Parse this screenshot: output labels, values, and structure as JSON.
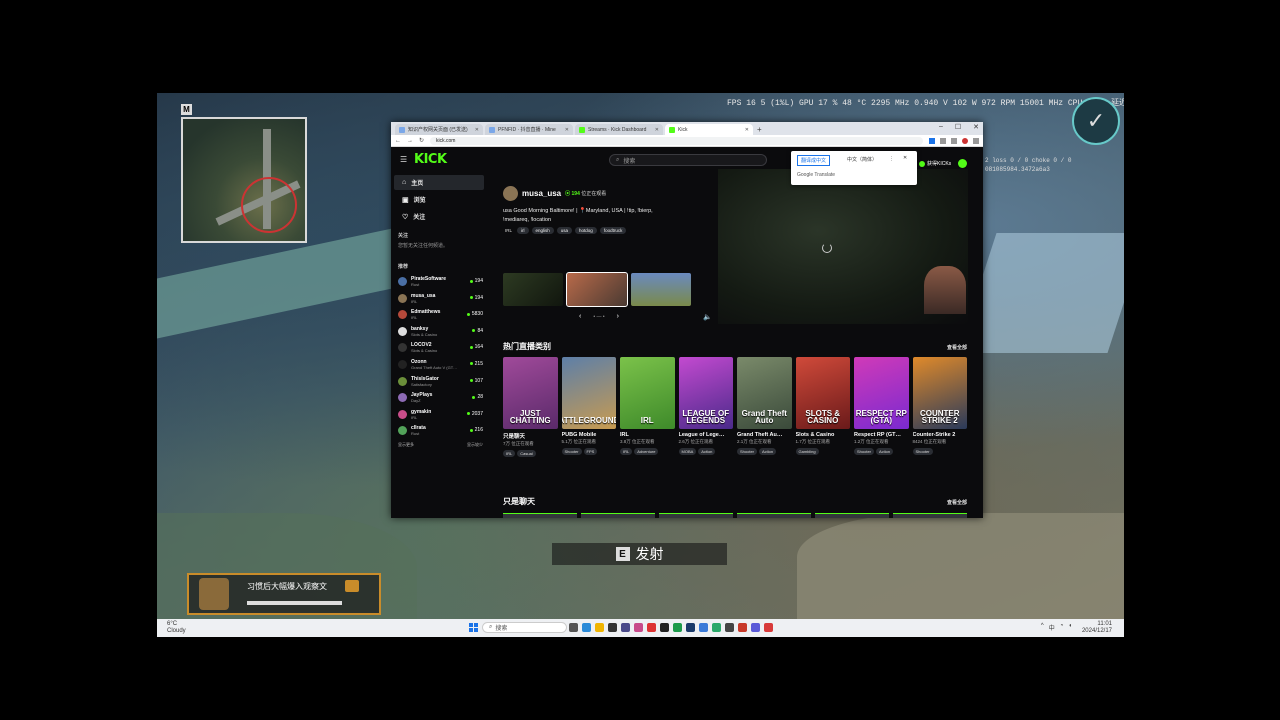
{
  "game": {
    "hud_stats": "FPS   16   5 (1%L)     GPU  17 %  48 °C  2295 MHz  0.940 V  102 W  972 RPM  15001 MHz   CPU  40 %   延迟  4.9 ms  80.3 ms",
    "minimap_key": "M",
    "fire_key": "E",
    "fire_label": "发射",
    "chat_text": "习惯后大幅爆入观察文",
    "overlay_text_1": "2  loss 0 / 0  choke 0 / 0",
    "overlay_text_2": "081085984.3472a6a3"
  },
  "taskbar": {
    "weather_temp": "6°C",
    "weather_desc": "Cloudy",
    "search_placeholder": "搜索",
    "time": "11:01",
    "date": "2024/12/17"
  },
  "browser": {
    "tabs": [
      {
        "title": "知识产权网关页面 (已发送)",
        "active": false
      },
      {
        "title": "PFNFID · 抖音直播 · Mine",
        "active": false
      },
      {
        "title": "Streams · Kick Dashboard",
        "active": false
      },
      {
        "title": "Kick",
        "active": true
      }
    ],
    "url": "kick.com",
    "translate_popup": {
      "option_1": "翻译成中文",
      "option_2": "中文（简体）",
      "footer": "Google Translate"
    }
  },
  "kick": {
    "logo": "KICK",
    "search_placeholder": "搜索",
    "get_kicks": "获得KICKs",
    "nav": [
      {
        "label": "主页",
        "icon": "home-icon",
        "active": true
      },
      {
        "label": "浏览",
        "icon": "browse-icon",
        "active": false
      },
      {
        "label": "关注",
        "icon": "heart-icon",
        "active": false
      }
    ],
    "following_title": "关注",
    "following_empty": "您暂无关注任何频道。",
    "recommended_title": "推荐",
    "channels": [
      {
        "name": "PirateSoftware",
        "game": "Rust",
        "viewers": "194",
        "color": "#4a6fa5"
      },
      {
        "name": "musa_usa",
        "game": "IRL",
        "viewers": "194",
        "color": "#8a7455"
      },
      {
        "name": "Edmatthews",
        "game": "IRL",
        "viewers": "5830",
        "color": "#b5493a"
      },
      {
        "name": "banksy",
        "game": "Slots & Casino",
        "viewers": "84",
        "color": "#dddddd"
      },
      {
        "name": "LOCOV2",
        "game": "Slots & Casino",
        "viewers": "164",
        "color": "#333333"
      },
      {
        "name": "Ozonn",
        "game": "Grand Theft Auto V (GT…",
        "viewers": "215",
        "color": "#222222"
      },
      {
        "name": "ThisIsGator",
        "game": "Satisfactory",
        "viewers": "107",
        "color": "#6b8f3a"
      },
      {
        "name": "JayPlays",
        "game": "DayZ",
        "viewers": "28",
        "color": "#8e6bb5"
      },
      {
        "name": "gymakin",
        "game": "IRL",
        "viewers": "2037",
        "color": "#c94d8a"
      },
      {
        "name": "cllrata",
        "game": "Rust",
        "viewers": "216",
        "color": "#53a35a"
      }
    ],
    "show_more": "显示更多",
    "show_less": "显示较少",
    "hero": {
      "channel": "musa_usa",
      "viewers": "194",
      "viewers_suffix": "位正在观看",
      "desc_line_1": "usa Good Morning Baltimore! | 📍Maryland, USA | !tip, !bierp,",
      "desc_line_2": "!mediareq, !location",
      "category": "IRL",
      "tags": [
        "irl",
        "english",
        "usa",
        "hotdog",
        "foodtruck"
      ]
    },
    "section_hot": "热门直播类别",
    "section_chat": "只是聊天",
    "view_all": "查看全部",
    "categories": [
      {
        "art": "JUST CHATTING",
        "name": "只是聊天",
        "viewers": "7万 位正在观看",
        "tags": [
          "IRL",
          "Casual"
        ],
        "c1": "#a04a9a",
        "c2": "#5a2a6a"
      },
      {
        "art": "BATTLEGROUNDS",
        "name": "PUBG Mobile",
        "viewers": "5.1万 位正在观看",
        "tags": [
          "Shooter",
          "FPS"
        ],
        "c1": "#5d7fa8",
        "c2": "#c89b50"
      },
      {
        "art": "IRL",
        "name": "IRL",
        "viewers": "3.8万 位正在观看",
        "tags": [
          "IRL",
          "Adventure"
        ],
        "c1": "#7bc24a",
        "c2": "#3e8a2a"
      },
      {
        "art": "LEAGUE OF LEGENDS",
        "name": "League of Lege…",
        "viewers": "2.6万 位正在观看",
        "tags": [
          "MOBA",
          "Action"
        ],
        "c1": "#c34ad0",
        "c2": "#4a2a8a"
      },
      {
        "art": "Grand Theft Auto",
        "name": "Grand Theft Au…",
        "viewers": "2.1万 位正在观看",
        "tags": [
          "Shooter",
          "Action"
        ],
        "c1": "#7a8a6a",
        "c2": "#3a4a3a"
      },
      {
        "art": "SLOTS & CASINO",
        "name": "Slots & Casino",
        "viewers": "1.7万 位正在观看",
        "tags": [
          "Gambling"
        ],
        "c1": "#d04a3a",
        "c2": "#6a1a1a"
      },
      {
        "art": "RESPECT RP (GTA)",
        "name": "Respect RP (GT…",
        "viewers": "1.2万 位正在观看",
        "tags": [
          "Shooter",
          "Action"
        ],
        "c1": "#d03ab8",
        "c2": "#7a2ad0"
      },
      {
        "art": "COUNTER STRIKE 2",
        "name": "Counter-Strike 2",
        "viewers": "8424 位正在观看",
        "tags": [
          "Shooter"
        ],
        "c1": "#e08a2a",
        "c2": "#2a3a5a"
      }
    ]
  }
}
